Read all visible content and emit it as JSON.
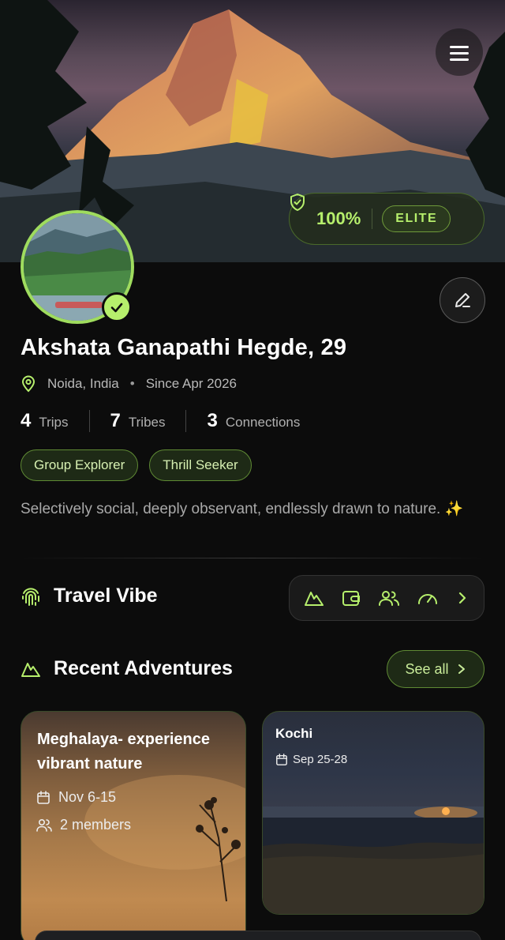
{
  "profile": {
    "completion": "100%",
    "tier": "ELITE",
    "name": "Akshata Ganapathi Hegde, 29",
    "location": "Noida, India",
    "dot": "•",
    "since": "Since Apr 2026",
    "bio": "Selectively social, deeply observant, endlessly drawn to nature. ✨"
  },
  "stats": [
    {
      "value": "4",
      "label": "Trips"
    },
    {
      "value": "7",
      "label": "Tribes"
    },
    {
      "value": "3",
      "label": "Connections"
    }
  ],
  "tags": [
    "Group Explorer",
    "Thrill Seeker"
  ],
  "travel_vibe": {
    "title": "Travel Vibe",
    "icons": [
      "mountain-icon",
      "wallet-icon",
      "group-icon",
      "speed-gauge-icon",
      "chevron-right-icon"
    ]
  },
  "recent": {
    "title": "Recent Adventures",
    "see_all": "See all",
    "cards": [
      {
        "title": "Meghalaya- experience vibrant nature",
        "dates": "Nov 6-15",
        "members": "2 members"
      },
      {
        "title": "Kochi",
        "dates": "Sep 25-28"
      }
    ]
  },
  "colors": {
    "accent": "#b6ef6c",
    "background": "#0c0c0c",
    "tag_border": "#5f8a34"
  }
}
